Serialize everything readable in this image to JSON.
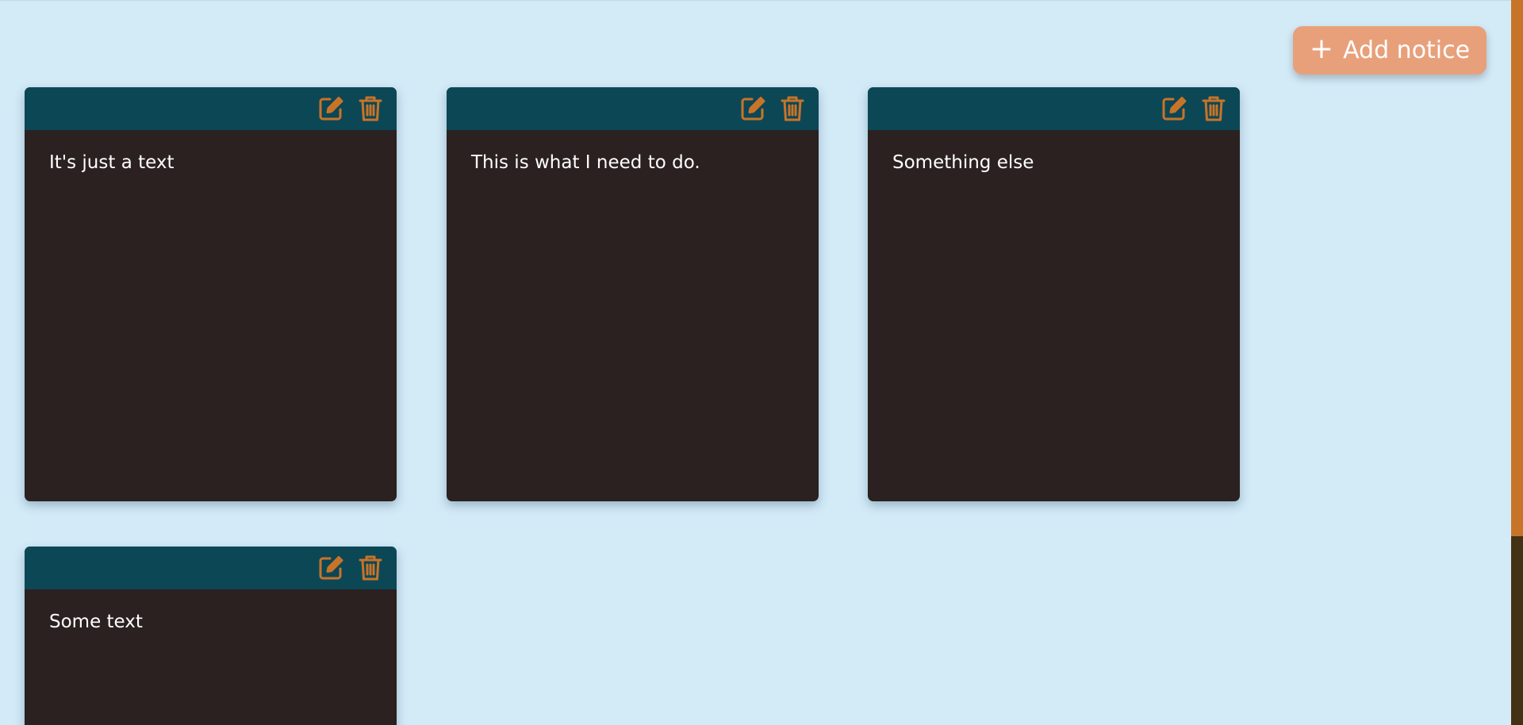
{
  "add_button": {
    "icon": "plus-icon",
    "label": "Add notice"
  },
  "notices": [
    {
      "text": "It's just a text"
    },
    {
      "text": "This is what I need to do."
    },
    {
      "text": "Something else"
    },
    {
      "text": "Some text"
    }
  ],
  "icons": {
    "edit": "edit-icon",
    "delete": "trash-icon"
  },
  "colors": {
    "page_bg": "#d3eaf7",
    "card_bg": "#2b2120",
    "card_header": "#0c4756",
    "icon_accent": "#c87428",
    "button_bg": "#e8a07b"
  }
}
